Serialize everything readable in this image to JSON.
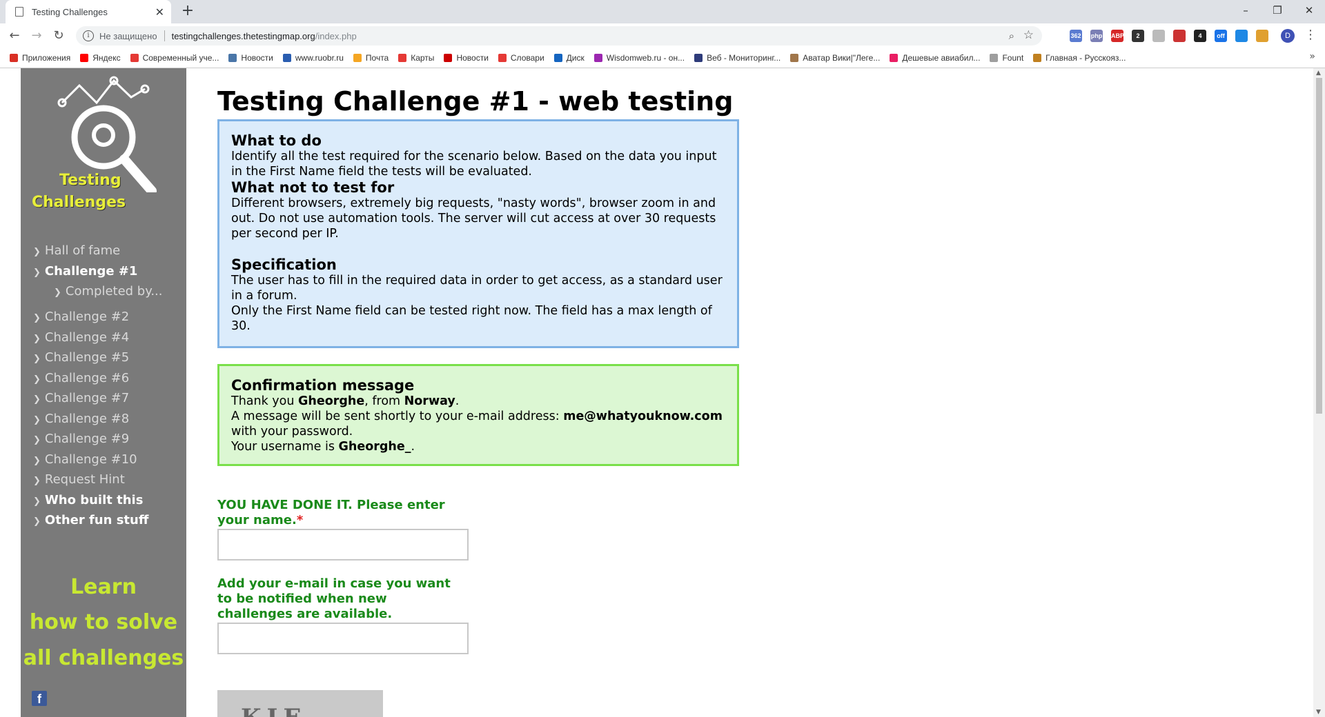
{
  "browser": {
    "tab_title": "Testing Challenges",
    "new_tab_glyph": "+",
    "close_glyph": "✕",
    "insecure_label": "Не защищено",
    "url_host": "testingchallenges.thetestingmap.org",
    "url_path": "/index.php",
    "profile_initial": "D",
    "extensions": [
      {
        "name": "mail-ext",
        "label": "362",
        "color": "#5a7bd1"
      },
      {
        "name": "php-ext",
        "label": "php",
        "color": "#7b7fb5"
      },
      {
        "name": "adblock-ext",
        "label": "ABP",
        "color": "#d62828"
      },
      {
        "name": "calendar-ext",
        "label": "2",
        "color": "#333333"
      },
      {
        "name": "ghost-ext",
        "label": "",
        "color": "#bbbbbb"
      },
      {
        "name": "todo-ext",
        "label": "",
        "color": "#cc3333"
      },
      {
        "name": "counter-ext",
        "label": "4",
        "color": "#222222"
      },
      {
        "name": "off-ext",
        "label": "off",
        "color": "#1a73e8"
      },
      {
        "name": "globe-ext",
        "label": "",
        "color": "#1e88e5"
      },
      {
        "name": "cookie-ext",
        "label": "",
        "color": "#e0a030"
      }
    ],
    "bookmarks": [
      {
        "label": "Приложения",
        "color": "#d93025"
      },
      {
        "label": "Яндекс",
        "color": "#ff0000"
      },
      {
        "label": "Современный уче...",
        "color": "#e53935"
      },
      {
        "label": "Новости",
        "color": "#4a76a8"
      },
      {
        "label": "www.ruobr.ru",
        "color": "#2a5db0"
      },
      {
        "label": "Почта",
        "color": "#f5a623"
      },
      {
        "label": "Карты",
        "color": "#e53935"
      },
      {
        "label": "Новости",
        "color": "#cc0000"
      },
      {
        "label": "Словари",
        "color": "#e53935"
      },
      {
        "label": "Диск",
        "color": "#1565c0"
      },
      {
        "label": "Wisdomweb.ru - он...",
        "color": "#9c27b0"
      },
      {
        "label": "Веб - Мониторинг...",
        "color": "#2e3b7a"
      },
      {
        "label": "Аватар Вики|\"Леге...",
        "color": "#a0764a"
      },
      {
        "label": "Дешевые авиабил...",
        "color": "#e91e63"
      },
      {
        "label": "Fount",
        "color": "#9e9e9e"
      },
      {
        "label": "Главная - Русскояз...",
        "color": "#c08020"
      }
    ],
    "more_bookmarks": "»"
  },
  "sidebar": {
    "logo_line1": "Testing",
    "logo_line2": "Challenges",
    "items": [
      {
        "label": "Hall of fame",
        "style": "normal"
      },
      {
        "label": "Challenge #1",
        "style": "active"
      },
      {
        "label": "Completed by...",
        "style": "sub"
      },
      {
        "label": "Challenge #2",
        "style": "normal"
      },
      {
        "label": "Challenge #4",
        "style": "normal"
      },
      {
        "label": "Challenge #5",
        "style": "normal"
      },
      {
        "label": "Challenge #6",
        "style": "normal"
      },
      {
        "label": "Challenge #7",
        "style": "normal"
      },
      {
        "label": "Challenge #8",
        "style": "normal"
      },
      {
        "label": "Challenge #9",
        "style": "normal"
      },
      {
        "label": "Challenge #10",
        "style": "normal"
      },
      {
        "label": "Request Hint",
        "style": "normal"
      },
      {
        "label": "Who built this",
        "style": "bold"
      },
      {
        "label": "Other fun stuff",
        "style": "bold"
      }
    ],
    "learn_lines": [
      "Learn",
      "how to solve",
      "all challenges"
    ],
    "facebook_glyph": "f"
  },
  "main": {
    "title": "Testing Challenge #1 - web testing",
    "info": {
      "h1": "What to do",
      "p1": "Identify all the test required for the scenario below. Based on the data you input in the First Name field the tests will be evaluated.",
      "h2": "What not to test for",
      "p2": "Different browsers, extremely big requests, \"nasty words\", browser zoom in and out. Do not use automation tools. The server will cut access at over 30 requests per second per IP.",
      "h3": "Specification",
      "p3a": "The user has to fill in the required data in order to get access, as a standard user in a forum.",
      "p3b": "Only the First Name field can be tested right now. The field has a max length of 30."
    },
    "confirm": {
      "h": "Confirmation message",
      "thank_pre": "Thank you ",
      "name": "Gheorghe",
      "from_mid": ", from ",
      "country": "Norway",
      "period": ".",
      "msg_pre": "A message will be sent shortly to your e-mail address: ",
      "email": "me@whatyouknow.com",
      "msg_post": "with your password.",
      "user_pre": "Your username is ",
      "username": "Gheorghe_",
      "user_post": "."
    },
    "form": {
      "name_label": "YOU HAVE DONE IT. Please enter your name.",
      "required_mark": "*",
      "name_value": "",
      "email_label": "Add your e-mail in case you want to be notified when new challenges are available.",
      "email_value": ""
    },
    "captcha_text": "KIE"
  }
}
